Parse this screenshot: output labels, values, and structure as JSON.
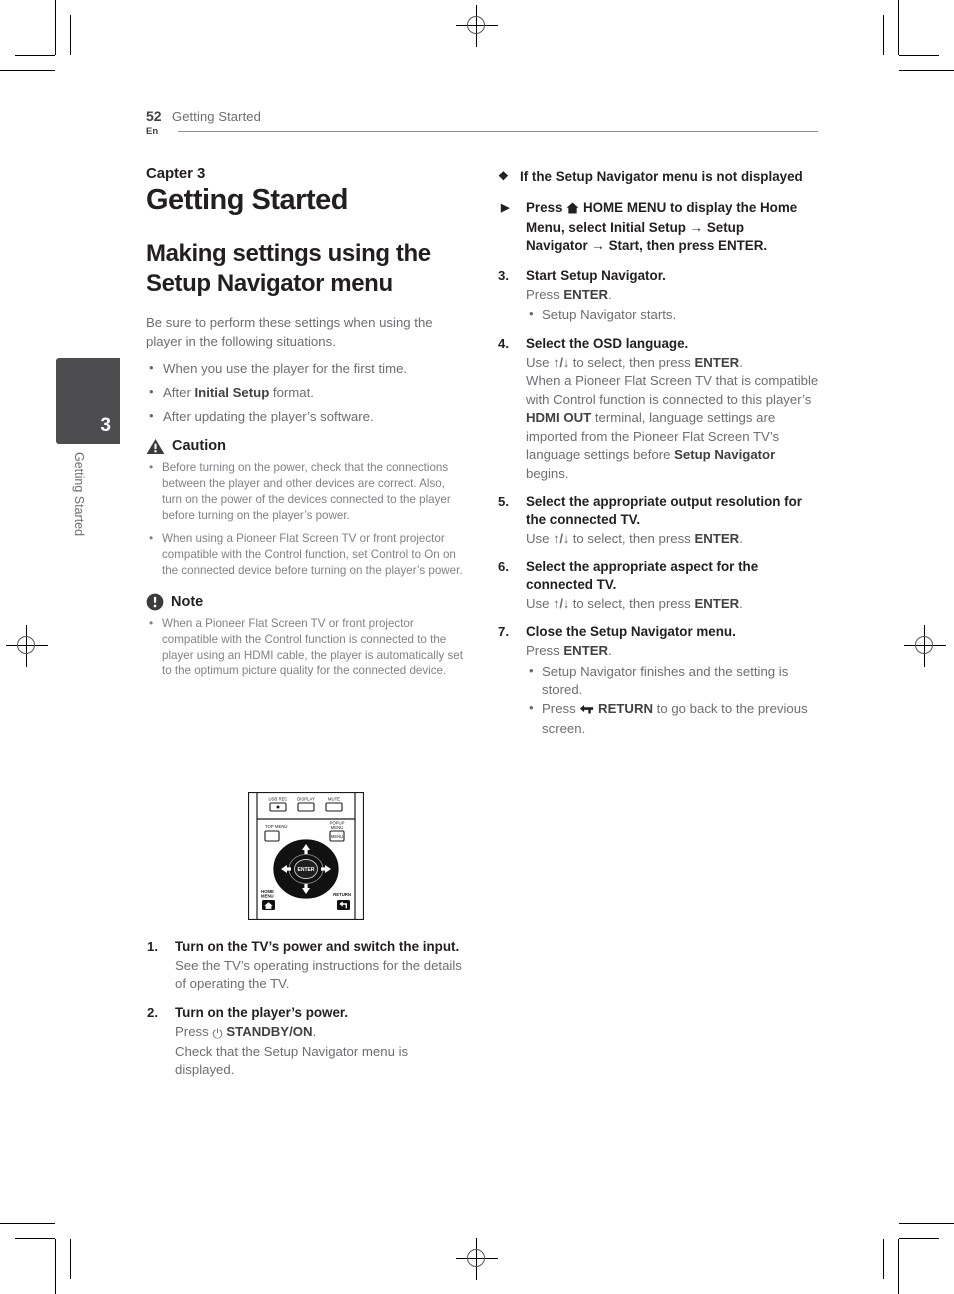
{
  "header": {
    "page_number": "52",
    "language_code": "En",
    "running_title": "Getting Started"
  },
  "sidebar": {
    "chapter_number": "3",
    "chapter_label": "Getting Started"
  },
  "left_column": {
    "chapter_eyebrow": "Capter 3",
    "chapter_title": "Getting Started",
    "section_title": "Making settings using the Setup Navigator menu",
    "intro": "Be sure to perform these settings when using the player in the following situations.",
    "intro_bullets": [
      {
        "text": "When you use the player for the first time."
      },
      {
        "pre": "After ",
        "bold": "Initial Setup",
        "post": " format."
      },
      {
        "text": "After updating the player’s software."
      }
    ],
    "caution": {
      "icon": "warning-triangle-icon",
      "title": "Caution",
      "items": [
        "Before turning on the power, check that the connections between the player and other devices are correct. Also, turn on the power of the devices connected to the player before turning on the player’s power.",
        "When using a Pioneer Flat Screen TV or front projector compatible with the Control function, set Control to On on the connected device before turning on the player’s power."
      ]
    },
    "note": {
      "icon": "note-exclamation-icon",
      "title": "Note",
      "items": [
        "When a Pioneer Flat Screen TV or front projector compatible with the Control function is connected to the player using an HDMI cable, the player is automatically set to the optimum picture quality for the connected device."
      ]
    },
    "remote_figure": {
      "name": "remote-control-diagram",
      "button_labels": [
        "USB REC",
        "DISPLAY",
        "MUTE",
        "TOP MENU",
        "POPUP MENU",
        "ENTER",
        "HOME MENU",
        "RETURN"
      ],
      "popup_menu_key_text": "MENU"
    },
    "steps": [
      {
        "num": "1.",
        "title": "Turn on the TV’s power and switch the input.",
        "body": "See the TV’s operating instructions for the details of operating the TV."
      },
      {
        "num": "2.",
        "title": "Turn on the player’s power.",
        "body_pre": "Press ",
        "body_icon": "power-standby-icon",
        "body_bold": "STANDBY/ON",
        "body_post": ".",
        "body_line2": "Check that the Setup Navigator menu is displayed."
      }
    ]
  },
  "right_column": {
    "diamond_heading": {
      "marker": "diamond-bullet-icon",
      "text": "If the Setup Navigator menu is not displayed"
    },
    "triangle_item": {
      "marker": "triangle-bullet-icon",
      "seg1": "Press ",
      "icon": "home-menu-icon",
      "seg2": " HOME MENU to display the Home Menu, select ",
      "seg3": "Initial Setup",
      "arrow1": "→",
      "seg4": "Setup Navigator",
      "arrow2": "→",
      "seg5": "Start, then press ENTER."
    },
    "steps": [
      {
        "num": "3.",
        "title": "Start Setup Navigator.",
        "body_pre": "Press ",
        "body_bold": "ENTER",
        "body_post": ".",
        "substeps": [
          "Setup Navigator starts."
        ]
      },
      {
        "num": "4.",
        "title_pre": "Select the ",
        "title_bold": "OSD",
        "title_post": " language.",
        "use_pre": "Use ",
        "use_arrows": "↑/↓",
        "use_post": " to select, then press ",
        "use_bold": "ENTER",
        "use_end": ".",
        "body2_pre": "When a Pioneer Flat Screen TV that is compatible with Control function is connected to this player’s ",
        "body2_bold": "HDMI OUT",
        "body2_mid": " terminal, language settings are imported from the Pioneer Flat Screen TV’s language settings before ",
        "body2_bold2": "Setup Navigator",
        "body2_end": " begins."
      },
      {
        "num": "5.",
        "title": "Select the appropriate output resolution for the connected TV.",
        "use_pre": "Use ",
        "use_arrows": "↑/↓",
        "use_post": " to select, then press ",
        "use_bold": "ENTER",
        "use_end": "."
      },
      {
        "num": "6.",
        "title": "Select the appropriate aspect for the connected TV.",
        "use_pre": "Use ",
        "use_arrows": "↑/↓",
        "use_post": " to select, then press ",
        "use_bold": "ENTER",
        "use_end": "."
      },
      {
        "num": "7.",
        "title": "Close the Setup Navigator menu.",
        "body_pre": "Press ",
        "body_bold": "ENTER",
        "body_post": ".",
        "substep1": "Setup Navigator finishes and the setting is stored.",
        "substep2_pre": "Press ",
        "substep2_icon": "return-arrow-icon",
        "substep2_bold": "RETURN",
        "substep2_post": " to go back to the previous screen."
      }
    ]
  },
  "colors": {
    "body_text": "#6d6e71",
    "heading_text": "#231f20",
    "admonition_text": "#808285",
    "tab_background": "#4d4d4f",
    "rule": "#939598"
  }
}
